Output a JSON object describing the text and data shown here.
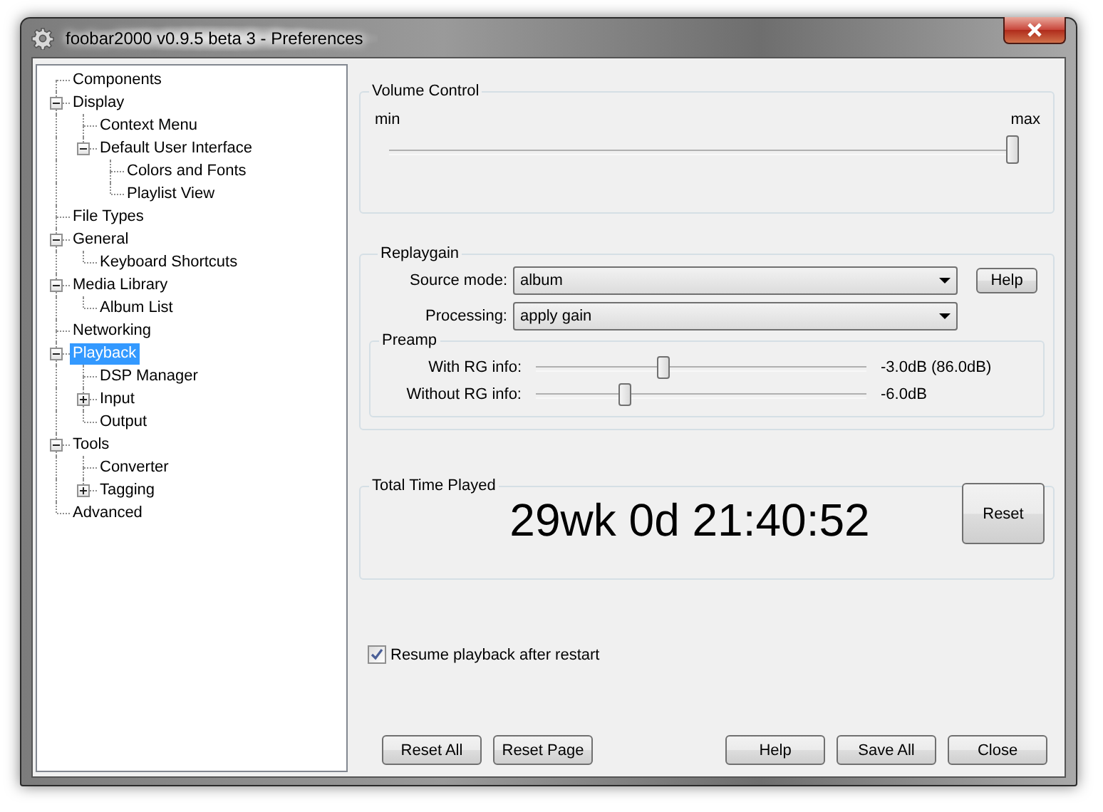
{
  "window": {
    "title": "foobar2000 v0.9.5 beta 3 - Preferences"
  },
  "tree": [
    {
      "label": "Components",
      "selected": false
    },
    {
      "label": "Display",
      "selected": false,
      "expanded": true,
      "children": [
        {
          "label": "Context Menu",
          "selected": false
        },
        {
          "label": "Default User Interface",
          "selected": false,
          "expanded": true,
          "children": [
            {
              "label": "Colors and Fonts",
              "selected": false
            },
            {
              "label": "Playlist View",
              "selected": false
            }
          ]
        }
      ]
    },
    {
      "label": "File Types",
      "selected": false
    },
    {
      "label": "General",
      "selected": false,
      "expanded": true,
      "children": [
        {
          "label": "Keyboard Shortcuts",
          "selected": false
        }
      ]
    },
    {
      "label": "Media Library",
      "selected": false,
      "expanded": true,
      "children": [
        {
          "label": "Album List",
          "selected": false
        }
      ]
    },
    {
      "label": "Networking",
      "selected": false
    },
    {
      "label": "Playback",
      "selected": true,
      "expanded": true,
      "children": [
        {
          "label": "DSP Manager",
          "selected": false
        },
        {
          "label": "Input",
          "selected": false,
          "expanded": false
        },
        {
          "label": "Output",
          "selected": false
        }
      ]
    },
    {
      "label": "Tools",
      "selected": false,
      "expanded": true,
      "children": [
        {
          "label": "Converter",
          "selected": false
        },
        {
          "label": "Tagging",
          "selected": false,
          "expanded": false
        }
      ]
    },
    {
      "label": "Advanced",
      "selected": false
    }
  ],
  "volume_control": {
    "title": "Volume Control",
    "min_label": "min",
    "max_label": "max",
    "level": 1.0
  },
  "replaygain": {
    "title": "Replaygain",
    "source_mode": {
      "label": "Source mode:",
      "value": "album"
    },
    "help_button": "Help",
    "processing": {
      "label": "Processing:",
      "value": "apply gain"
    },
    "preamp": {
      "title": "Preamp",
      "sliders": [
        {
          "label": "With RG info:",
          "level": 0.38,
          "reading": "-3.0dB (86.0dB)"
        },
        {
          "label": "Without RG info:",
          "level": 0.26,
          "reading": "-6.0dB"
        }
      ]
    }
  },
  "total_time_played": {
    "title": "Total Time Played",
    "value": "29wk 0d 21:40:52",
    "reset_button": "Reset"
  },
  "resume_playback": {
    "label": "Resume playback after restart",
    "checked": true
  },
  "footer_buttons": {
    "left": [
      "Reset All",
      "Reset Page"
    ],
    "right": [
      "Help",
      "Save All",
      "Close"
    ]
  }
}
